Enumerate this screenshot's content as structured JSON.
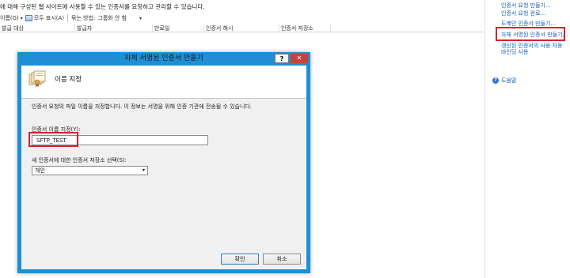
{
  "main": {
    "description": "에 대해 구성된 웹 사이트에 사용할 수 있는 인증서를 요청하고 관리할 수 있습니다.",
    "filter": {
      "label": "이름(G)",
      "show_all": "모두 표시(A)",
      "group_by_label": "묶는 방법:",
      "group_by_value": "그룹화 안 함"
    },
    "columns": [
      "발급 대상",
      "발급자",
      "만료일",
      "인증서 해시",
      "인증서 저장소"
    ]
  },
  "actions": {
    "items": [
      "인증서 요청 만들기...",
      "인증서 요청 완료...",
      "도메인 인증서 만들기...",
      "자체 서명된 인증서 만들기...",
      "갱신된 인증서의 사용 자동 바인딩 사용",
      "도움말"
    ]
  },
  "dialog": {
    "title": "자체 서명된 인증서 만들기",
    "help_glyph": "?",
    "close_glyph": "✕",
    "header": "이름 지정",
    "body": "인증서 요청의 파일 이름을 지정합니다. 이 정보는 서명을 위해 인증 기관에 전송될 수 있습니다.",
    "name_label": "인증서 이름 지정(Y):",
    "name_value": "SFTP_TEST",
    "store_label": "새 인증서에 대한 인증서 저장소 선택(S):",
    "store_value": "개인",
    "ok": "확인",
    "cancel": "취소"
  },
  "colors": {
    "dialog_frame": "#1e8fd5",
    "highlight": "#d8212b",
    "link": "#1a5fb4",
    "close_button": "#c9423a"
  }
}
